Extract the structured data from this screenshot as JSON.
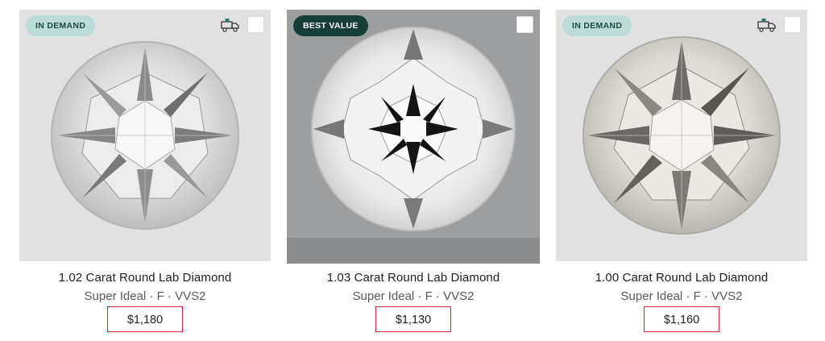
{
  "products": [
    {
      "badge": "IN DEMAND",
      "title": "1.02 Carat Round Lab Diamond",
      "specs": "Super Ideal · F · VVS2",
      "price": "$1,180",
      "shipping_icon": "truck-icon"
    },
    {
      "badge": "BEST VALUE",
      "title": "1.03 Carat Round Lab Diamond",
      "specs": "Super Ideal · F · VVS2",
      "price": "$1,130"
    },
    {
      "badge": "IN DEMAND",
      "title": "1.00 Carat Round Lab Diamond",
      "specs": "Super Ideal · F · VVS2",
      "price": "$1,160",
      "shipping_icon": "truck-icon"
    }
  ],
  "colors": {
    "badge_demand_bg": "#bcdcd8",
    "badge_value_bg": "#163f3a",
    "price_highlight": "#d9242b"
  }
}
